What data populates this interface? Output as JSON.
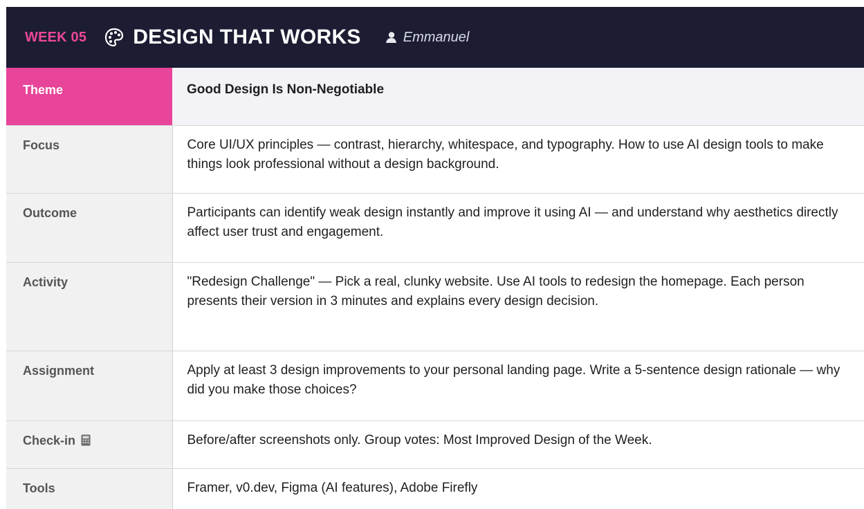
{
  "header": {
    "week": "WEEK 05",
    "title": "DESIGN THAT WORKS",
    "author": "Emmanuel",
    "icons": {
      "title_icon": "palette-icon",
      "author_icon": "user-icon"
    }
  },
  "colors": {
    "header_bg": "#1c1d33",
    "accent_pink": "#e8449a",
    "label_bg": "#f1f1f1"
  },
  "rows": [
    {
      "label": "Theme",
      "value": "Good Design Is Non-Negotiable"
    },
    {
      "label": "Focus",
      "value": "Core UI/UX principles — contrast, hierarchy, whitespace, and typography. How to use AI design tools to make things look professional without a design background."
    },
    {
      "label": "Outcome",
      "value": "Participants can identify weak design instantly and improve it using AI — and understand why aesthetics directly affect user trust and engagement."
    },
    {
      "label": "Activity",
      "value": "\"Redesign Challenge\" — Pick a real, clunky website. Use AI tools to redesign the homepage. Each person presents their version in 3 minutes and explains every design decision."
    },
    {
      "label": "Assignment",
      "value": "Apply at least 3 design improvements to your personal landing page. Write a 5-sentence design rationale — why did you make those choices?"
    },
    {
      "label": "Check-in",
      "value": "Before/after screenshots only. Group votes: Most Improved Design of the Week.",
      "icon": "calculator-icon"
    },
    {
      "label": "Tools",
      "value": "Framer, v0.dev, Figma (AI features), Adobe Firefly"
    }
  ]
}
